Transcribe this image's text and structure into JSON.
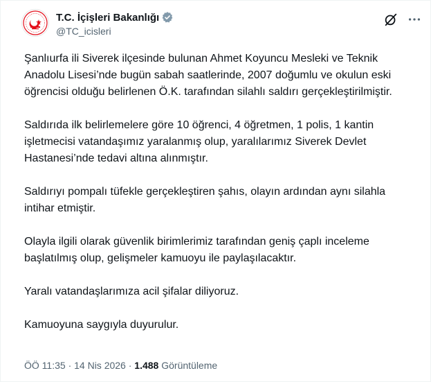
{
  "author": {
    "display_name": "T.C. İçişleri Bakanlığı",
    "handle": "@TC_icisleri",
    "verified_badge_icon": "verified-gray-badge-icon",
    "badge_color": "#829aab",
    "avatar_icon": "ministry-emblem-icon"
  },
  "header_actions": {
    "grok_icon": "grok-icon",
    "more_icon": "more-icon"
  },
  "paragraphs": [
    "Şanlıurfa ili Siverek ilçesinde bulunan Ahmet Koyuncu Mesleki ve Teknik Anadolu Lisesi’nde bugün sabah saatlerinde, 2007 doğumlu ve okulun eski öğrencisi olduğu belirlenen Ö.K. tarafından silahlı saldırı gerçekleştirilmiştir.",
    "Saldırıda ilk belirlemelere göre 10 öğrenci, 4 öğretmen, 1 polis, 1 kantin işletmecisi vatandaşımız yaralanmış olup, yaralılarımız Siverek Devlet Hastanesi’nde tedavi altına alınmıştır.",
    "Saldırıyı pompalı tüfekle gerçekleştiren şahıs, olayın ardından aynı silahla intihar etmiştir.",
    "Olayla ilgili olarak güvenlik birimlerimiz tarafından geniş çaplı inceleme başlatılmış olup, gelişmeler kamuoyu ile paylaşılacaktır.",
    "Yaralı vatandaşlarımıza acil şifalar diliyoruz.",
    "Kamuoyuna saygıyla duyurulur."
  ],
  "meta": {
    "time": "ÖÖ 11:35",
    "separator": "·",
    "date": "14 Nis 2026",
    "views_count": "1.488",
    "views_label": "Görüntüleme"
  },
  "colors": {
    "text": "#0f1419",
    "secondary": "#536471",
    "emblem_red": "#e30a17"
  }
}
